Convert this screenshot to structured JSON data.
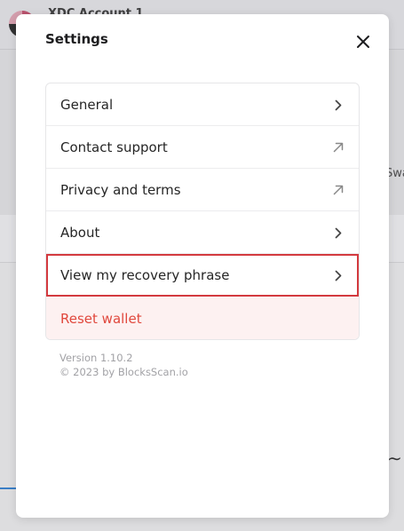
{
  "background": {
    "account_name": "XDC Account 1",
    "action_label": "Swa"
  },
  "settings": {
    "title": "Settings",
    "items": [
      {
        "label": "General",
        "icon": "chevron-right-icon"
      },
      {
        "label": "Contact support",
        "icon": "external-link-icon"
      },
      {
        "label": "Privacy and terms",
        "icon": "external-link-icon"
      },
      {
        "label": "About",
        "icon": "chevron-right-icon"
      },
      {
        "label": "View my recovery phrase",
        "icon": "chevron-right-icon"
      }
    ],
    "reset_label": "Reset wallet",
    "version": "Version 1.10.2",
    "copyright": "© 2023 by BlocksScan.io"
  },
  "colors": {
    "danger": "#e0483d",
    "highlight_border": "#d33a3f",
    "reset_background": "#fdf1f1"
  }
}
